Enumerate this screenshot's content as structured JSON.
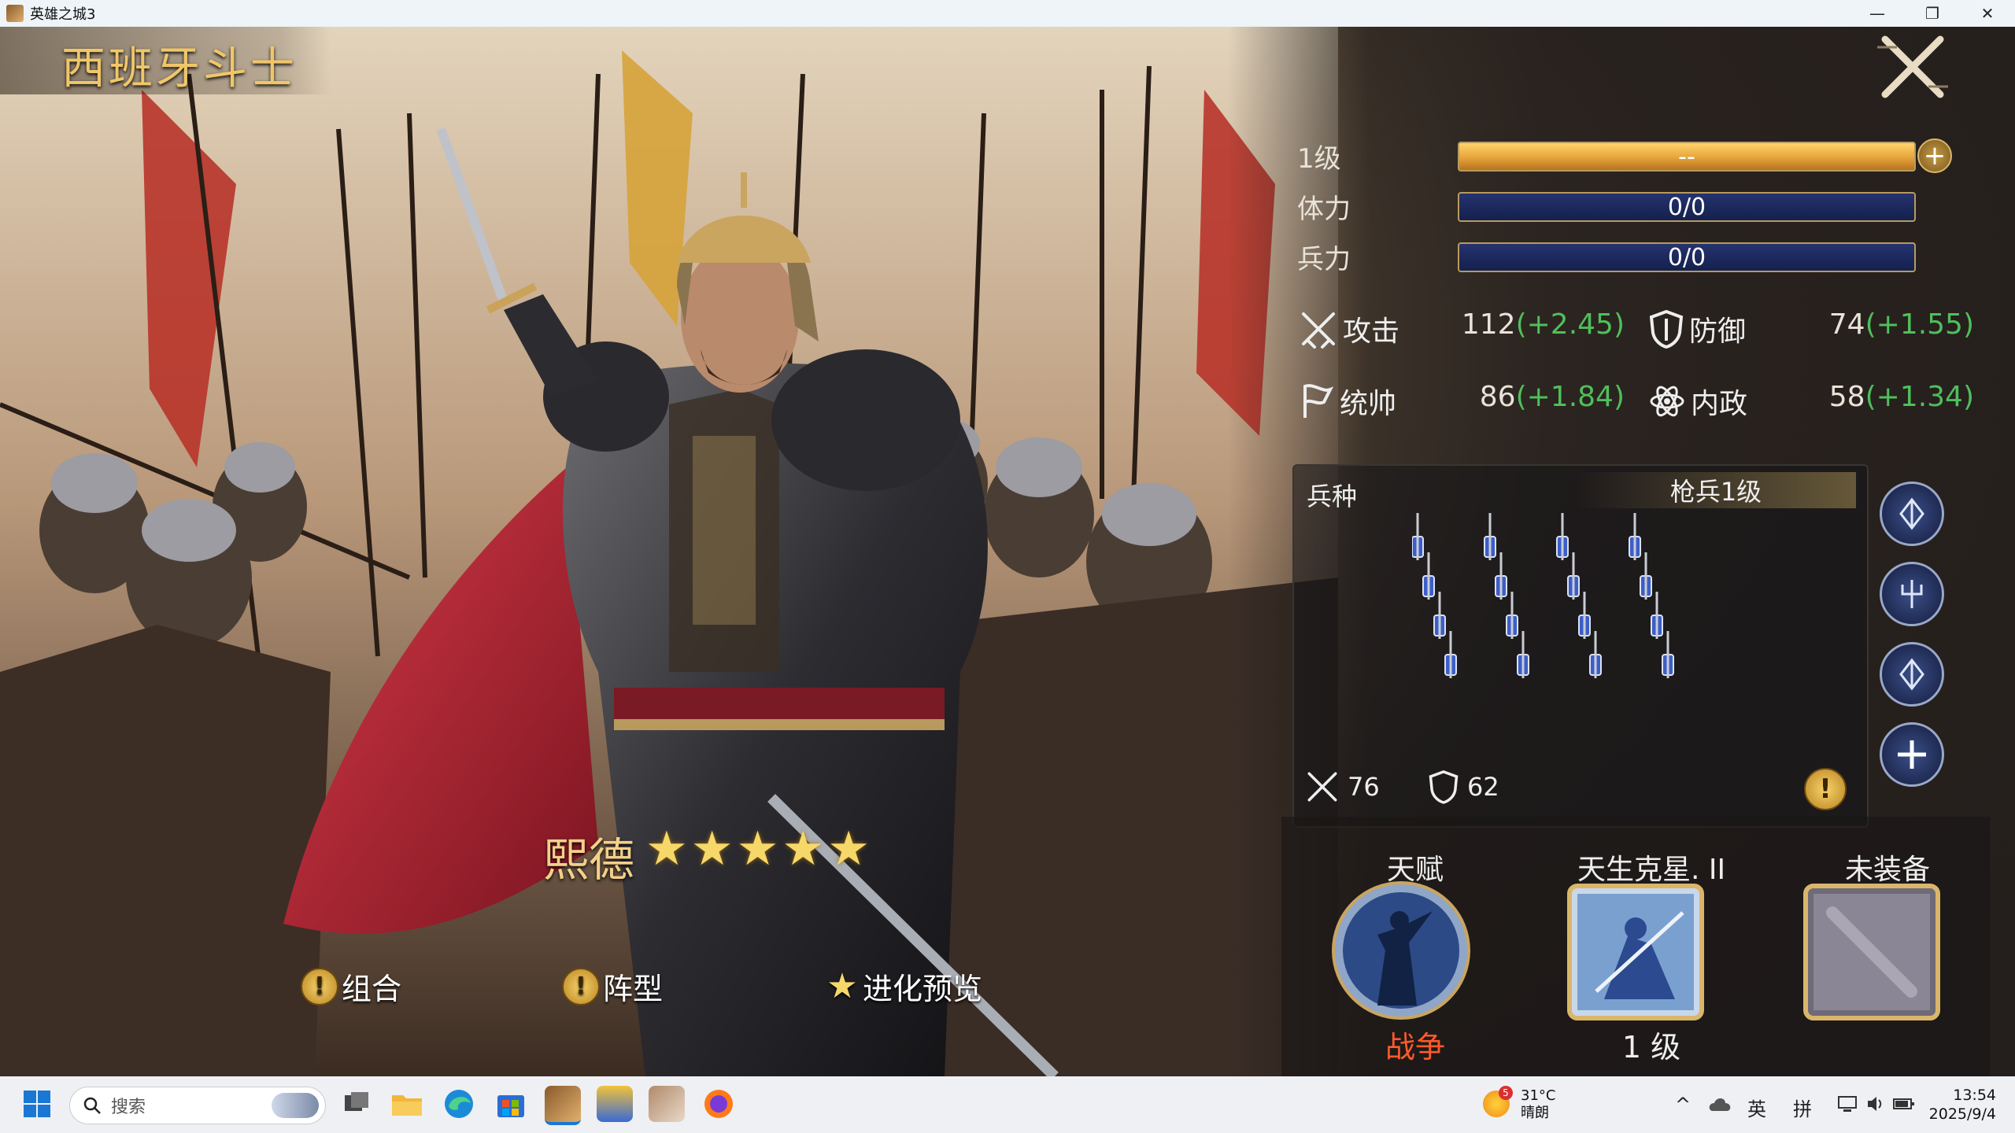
{
  "window": {
    "title": "英雄之城3",
    "minimize": "—",
    "restore": "❐",
    "close": "✕"
  },
  "unit": {
    "name": "西班牙斗士",
    "hero_name": "熙德",
    "star_count": 5
  },
  "stats": {
    "level_label": "1级",
    "level_bar_text": "--",
    "level_progress": 1.0,
    "stamina_label": "体力",
    "stamina_value": "0/0",
    "troops_label": "兵力",
    "troops_value": "0/0"
  },
  "attributes": [
    {
      "name": "攻击",
      "icon": "crossed-swords-icon",
      "base": "112",
      "bonus": "(+2.45)"
    },
    {
      "name": "防御",
      "icon": "shield-icon",
      "base": "74",
      "bonus": "(+1.55)"
    },
    {
      "name": "统帅",
      "icon": "banner-icon",
      "base": "86",
      "bonus": "(+1.84)"
    },
    {
      "name": "内政",
      "icon": "atom-icon",
      "base": "58",
      "bonus": "(+1.34)"
    }
  ],
  "troop_panel": {
    "label": "兵种",
    "tier": "枪兵1级",
    "attack": "76",
    "defense": "62",
    "warning": "!"
  },
  "skills": [
    {
      "title": "天赋",
      "subtitle": "战争"
    },
    {
      "title": "天生克星. II",
      "subtitle": "1 级"
    },
    {
      "title": "未装备",
      "subtitle": ""
    }
  ],
  "bottom_buttons": [
    {
      "label": "组合",
      "icon": "!"
    },
    {
      "label": "阵型",
      "icon": "!"
    },
    {
      "label": "进化预览",
      "icon": "★"
    }
  ],
  "star_glyph": "★",
  "taskbar": {
    "search_placeholder": "搜索",
    "weather_temp": "31°C",
    "weather_desc": "晴朗",
    "weather_badge": "5",
    "ime_lang": "英",
    "ime_mode": "拼",
    "time": "13:54",
    "date": "2025/9/4"
  },
  "colors": {
    "accent_gold": "#f0c66a",
    "bonus_green": "#4fbf5b",
    "war_red": "#ff5a2a"
  }
}
